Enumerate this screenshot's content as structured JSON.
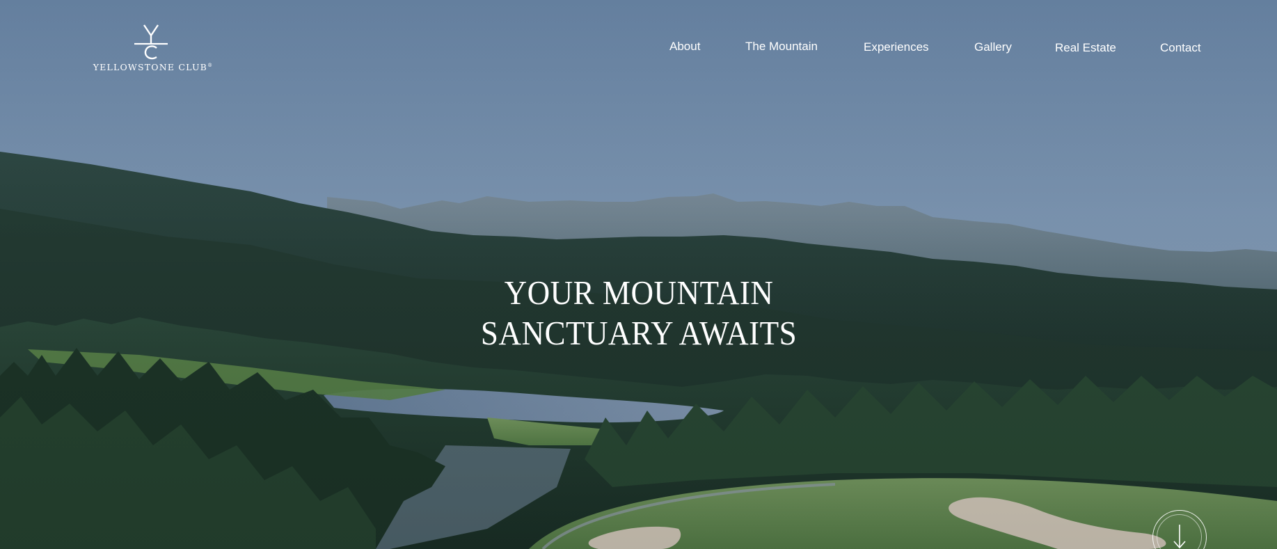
{
  "brand": {
    "wordmark": "YELLOWSTONE CLUB",
    "registered": "®",
    "monogram_icon": "yc-monogram-icon"
  },
  "nav": {
    "items": [
      {
        "label": "About"
      },
      {
        "label": "The Mountain"
      },
      {
        "label": "Experiences"
      },
      {
        "label": "Gallery"
      },
      {
        "label": "Real Estate"
      },
      {
        "label": "Contact"
      }
    ]
  },
  "hero": {
    "headline_line1": "YOUR MOUNTAIN",
    "headline_line2": "SANCTUARY AWAITS",
    "scroll_icon": "arrow-down-icon"
  },
  "colors": {
    "sky_top": "#6e8bab",
    "sky_bottom": "#8fa6bf",
    "forest_dark": "#1f3a2e",
    "fairway": "#6f9a5a",
    "text": "#ffffff"
  }
}
